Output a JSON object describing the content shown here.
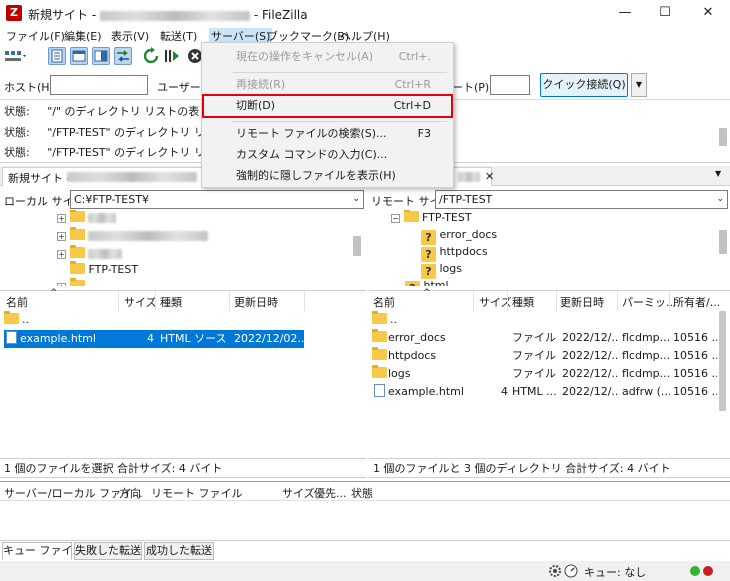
{
  "window": {
    "title_prefix": "新規サイト -",
    "title_suffix": "- FileZilla",
    "app_icon": "Z",
    "controls": [
      "minimize-icon",
      "maximize-icon",
      "close-icon"
    ]
  },
  "menu": [
    "ファイル(F)",
    "編集(E)",
    "表示(V)",
    "転送(T)",
    "サーバー(S)",
    "ブックマーク(B)",
    "ヘルプ(H)"
  ],
  "quickconnect": {
    "host_label": "ホスト(H):",
    "user_label": "ユーザー名",
    "port_label": "ート(P):",
    "button": "クイック接続(Q)",
    "dropdown": "▼"
  },
  "log": [
    {
      "label": "状態:",
      "text": "\"/\" のディレクトリ リストの表"
    },
    {
      "label": "状態:",
      "text": "\"/FTP-TEST\" のディレクトリ リ"
    },
    {
      "label": "状態:",
      "text": "\"/FTP-TEST\" のディレクトリ リ"
    }
  ],
  "site_tab": {
    "label": "新規サイト -",
    "close": "✕"
  },
  "local": {
    "path_label": "ローカル サイト:",
    "path": "C:¥FTP-TEST¥",
    "tree": [
      "FTP-TEST"
    ],
    "columns": [
      "名前",
      "サイズ",
      "種類",
      "更新日時"
    ],
    "files": [
      {
        "name": "..",
        "size": "",
        "type": "",
        "date": ""
      },
      {
        "name": "example.html",
        "size": "4",
        "type": "HTML ソース ...",
        "date": "2022/12/02..."
      }
    ],
    "status": "1 個のファイルを選択 合計サイズ: 4 バイト"
  },
  "remote": {
    "path_label": "リモート サイト:",
    "path": "/FTP-TEST",
    "tree": [
      "FTP-TEST",
      "error_docs",
      "httpdocs",
      "logs",
      "html"
    ],
    "columns": [
      "名前",
      "サイズ",
      "種類",
      "更新日時",
      "パーミッ...",
      "所有者/..."
    ],
    "files": [
      {
        "name": "..",
        "size": "",
        "type": "",
        "date": "",
        "perm": "",
        "owner": ""
      },
      {
        "name": "error_docs",
        "size": "",
        "type": "ファイル ...",
        "date": "2022/12/...",
        "perm": "flcdmp...",
        "owner": "10516 ..."
      },
      {
        "name": "httpdocs",
        "size": "",
        "type": "ファイル ...",
        "date": "2022/12/...",
        "perm": "flcdmp...",
        "owner": "10516 ..."
      },
      {
        "name": "logs",
        "size": "",
        "type": "ファイル ...",
        "date": "2022/12/...",
        "perm": "flcdmp...",
        "owner": "10516 ..."
      },
      {
        "name": "example.html",
        "size": "4",
        "type": "HTML ...",
        "date": "2022/12/...",
        "perm": "adfrw (...",
        "owner": "10516 ..."
      }
    ],
    "status": "1 個のファイルと 3 個のディレクトリ 合計サイズ: 4 バイト"
  },
  "queue": {
    "columns": [
      "サーバー/ローカル ファイ...",
      "方向",
      "リモート ファイル",
      "サイズ",
      "優先...",
      "状態"
    ],
    "tabs": [
      "キュー ファイル",
      "失敗した転送",
      "成功した転送"
    ],
    "status": "キュー: なし"
  },
  "context_menu": [
    {
      "label": "現在の操作をキャンセル(A)",
      "shortcut": "Ctrl+.",
      "disabled": true
    },
    {
      "label": "再接続(R)",
      "shortcut": "Ctrl+R",
      "disabled": true
    },
    {
      "label": "切断(D)",
      "shortcut": "Ctrl+D",
      "disabled": false
    },
    {
      "label": "リモート ファイルの検索(S)...",
      "shortcut": "F3",
      "disabled": false
    },
    {
      "label": "カスタム コマンドの入力(C)...",
      "shortcut": "",
      "disabled": false
    },
    {
      "label": "強制的に隠しファイルを表示(H)",
      "shortcut": "",
      "disabled": false
    }
  ],
  "colors": {
    "highlight_border": "#e60012",
    "selection": "#0078d7",
    "accent": "#0078d7"
  }
}
